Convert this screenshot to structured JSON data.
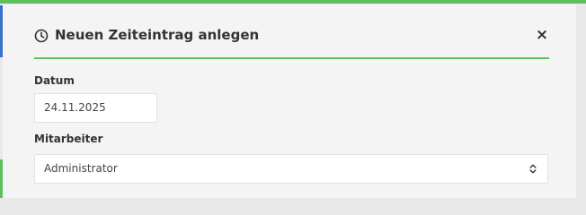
{
  "modal": {
    "title": "Neuen Zeiteintrag anlegen",
    "close_label": "×",
    "title_icon": "clock-icon"
  },
  "form": {
    "date": {
      "label": "Datum",
      "value": "24.11.2025"
    },
    "employee": {
      "label": "Mitarbeiter",
      "selected": "Administrator",
      "icon": "chevron-up-down-icon"
    }
  },
  "colors": {
    "accent": "#5fbf5f",
    "backdrop_accent": "#3a70c8",
    "modal_bg": "#f4f4f4"
  }
}
